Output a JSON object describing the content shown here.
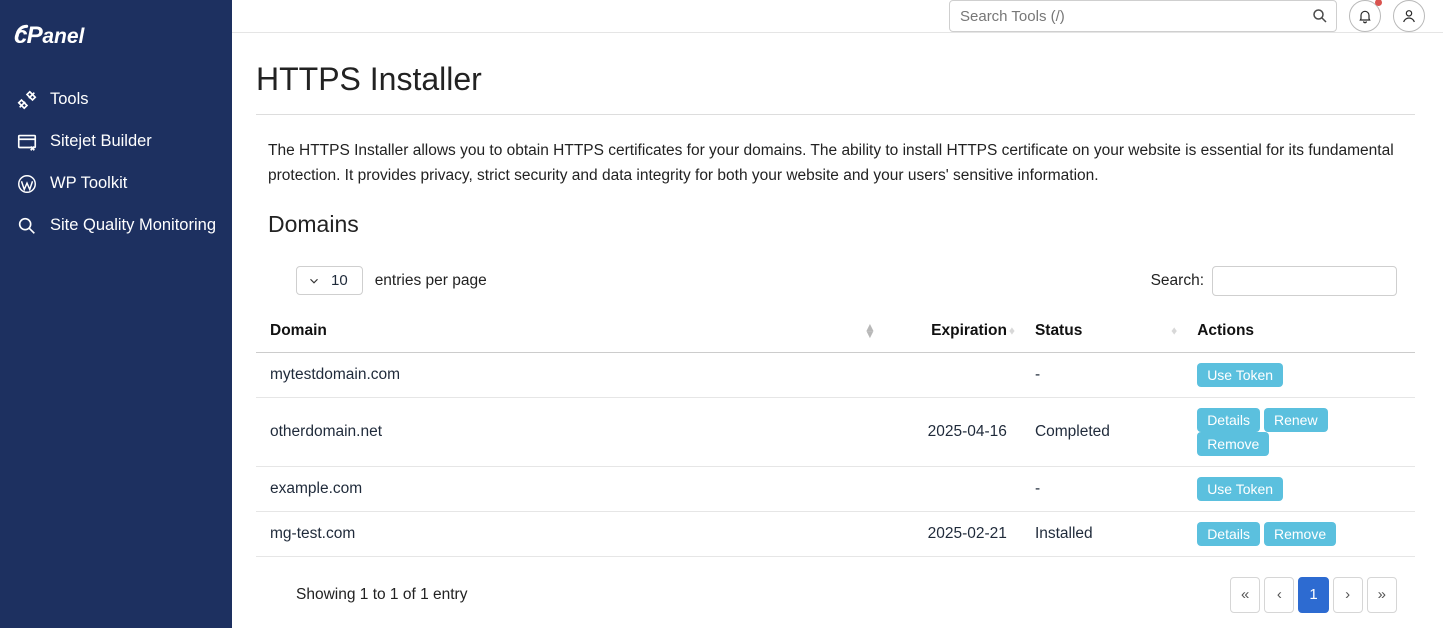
{
  "brand": "cPanel",
  "sidebar": {
    "items": [
      {
        "label": "Tools"
      },
      {
        "label": "Sitejet Builder"
      },
      {
        "label": "WP Toolkit"
      },
      {
        "label": "Site Quality Monitoring"
      }
    ]
  },
  "header": {
    "search_placeholder": "Search Tools (/)"
  },
  "page": {
    "title": "HTTPS Installer",
    "description": "The HTTPS Installer allows you to obtain HTTPS certificates for your domains. The ability to install HTTPS certificate on your website is essential for its fundamental protection. It provides privacy, strict security and data integrity for both your website and your users' sensitive information.",
    "domains_heading": "Domains"
  },
  "table": {
    "entries_value": "10",
    "entries_label": "entries per page",
    "search_label": "Search:",
    "columns": {
      "domain": "Domain",
      "expiration": "Expiration",
      "status": "Status",
      "actions": "Actions"
    },
    "rows": [
      {
        "domain": "mytestdomain.com",
        "expiration": "",
        "status": "-",
        "actions": [
          "Use Token"
        ]
      },
      {
        "domain": "otherdomain.net",
        "expiration": "2025-04-16",
        "status": "Completed",
        "actions": [
          "Details",
          "Renew",
          "Remove"
        ]
      },
      {
        "domain": "example.com",
        "expiration": "",
        "status": "-",
        "actions": [
          "Use Token"
        ]
      },
      {
        "domain": "mg-test.com",
        "expiration": "2025-02-21",
        "status": "Installed",
        "actions": [
          "Details",
          "Remove"
        ]
      }
    ],
    "showing": "Showing 1 to 1 of 1 entry",
    "pager": {
      "first": "«",
      "prev": "‹",
      "current": "1",
      "next": "›",
      "last": "»"
    }
  }
}
